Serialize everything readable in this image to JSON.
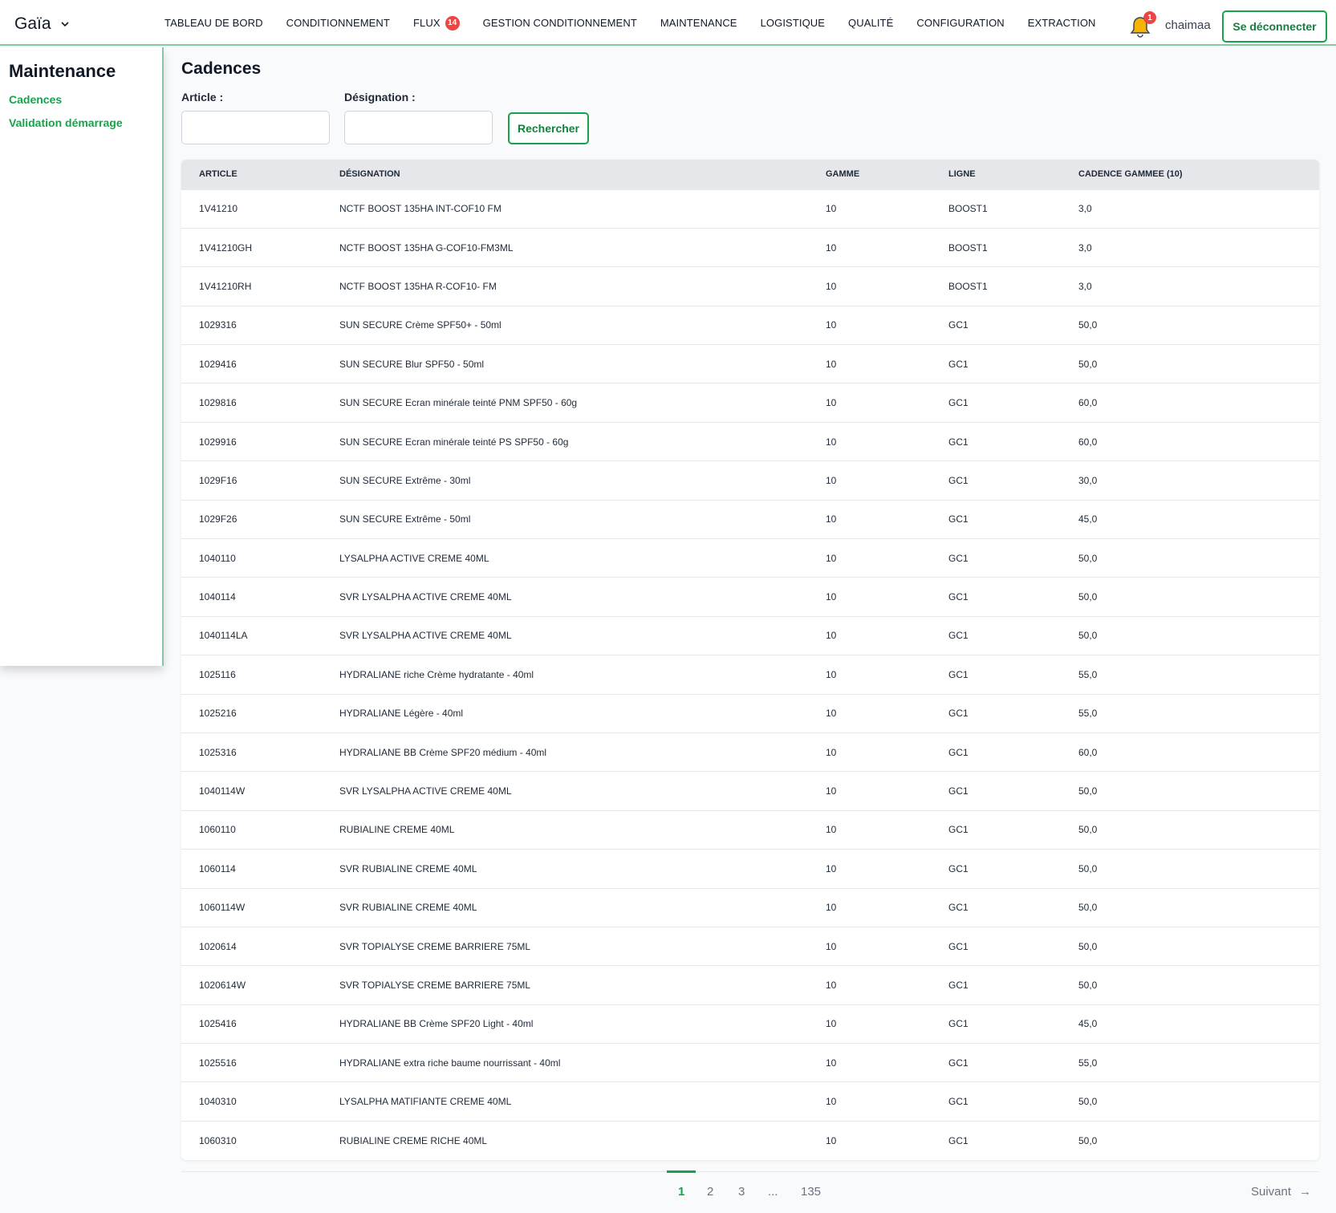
{
  "header": {
    "brand": "Gaïa",
    "nav": [
      {
        "label": "TABLEAU DE BORD"
      },
      {
        "label": "CONDITIONNEMENT"
      },
      {
        "label": "FLUX",
        "badge": "14"
      },
      {
        "label": "GESTION CONDITIONNEMENT"
      },
      {
        "label": "MAINTENANCE"
      },
      {
        "label": "LOGISTIQUE"
      },
      {
        "label": "QUALITÉ"
      },
      {
        "label": "CONFIGURATION"
      },
      {
        "label": "EXTRACTION"
      }
    ],
    "notification_count": "1",
    "username": "chaimaa",
    "logout_label": "Se déconnecter"
  },
  "sidebar": {
    "title": "Maintenance",
    "links": [
      {
        "label": "Cadences"
      },
      {
        "label": "Validation démarrage"
      }
    ]
  },
  "main": {
    "title": "Cadences",
    "filters": {
      "article_label": "Article :",
      "article_value": "",
      "designation_label": "Désignation :",
      "designation_value": "",
      "search_label": "Rechercher"
    },
    "table": {
      "columns": [
        "ARTICLE",
        "DÉSIGNATION",
        "GAMME",
        "LIGNE",
        "CADENCE GAMMEE (10)"
      ],
      "rows": [
        [
          "1V41210",
          "NCTF BOOST 135HA INT-COF10 FM",
          "10",
          "BOOST1",
          "3,0"
        ],
        [
          "1V41210GH",
          "NCTF BOOST 135HA G-COF10-FM3ML",
          "10",
          "BOOST1",
          "3,0"
        ],
        [
          "1V41210RH",
          "NCTF BOOST 135HA R-COF10- FM",
          "10",
          "BOOST1",
          "3,0"
        ],
        [
          "1029316",
          "SUN SECURE Crème SPF50+ - 50ml",
          "10",
          "GC1",
          "50,0"
        ],
        [
          "1029416",
          "SUN SECURE Blur SPF50 - 50ml",
          "10",
          "GC1",
          "50,0"
        ],
        [
          "1029816",
          "SUN SECURE Ecran minérale teinté PNM SPF50 - 60g",
          "10",
          "GC1",
          "60,0"
        ],
        [
          "1029916",
          "SUN SECURE Ecran minérale teinté PS SPF50 - 60g",
          "10",
          "GC1",
          "60,0"
        ],
        [
          "1029F16",
          "SUN SECURE Extrême - 30ml",
          "10",
          "GC1",
          "30,0"
        ],
        [
          "1029F26",
          "SUN SECURE Extrême - 50ml",
          "10",
          "GC1",
          "45,0"
        ],
        [
          "1040110",
          "LYSALPHA ACTIVE CREME 40ML",
          "10",
          "GC1",
          "50,0"
        ],
        [
          "1040114",
          "SVR LYSALPHA ACTIVE CREME 40ML",
          "10",
          "GC1",
          "50,0"
        ],
        [
          "1040114LA",
          "SVR LYSALPHA ACTIVE CREME 40ML",
          "10",
          "GC1",
          "50,0"
        ],
        [
          "1025116",
          "HYDRALIANE riche Crème hydratante - 40ml",
          "10",
          "GC1",
          "55,0"
        ],
        [
          "1025216",
          "HYDRALIANE Légère - 40ml",
          "10",
          "GC1",
          "55,0"
        ],
        [
          "1025316",
          "HYDRALIANE BB Crème SPF20 médium - 40ml",
          "10",
          "GC1",
          "60,0"
        ],
        [
          "1040114W",
          "SVR LYSALPHA ACTIVE CREME 40ML",
          "10",
          "GC1",
          "50,0"
        ],
        [
          "1060110",
          "RUBIALINE CREME 40ML",
          "10",
          "GC1",
          "50,0"
        ],
        [
          "1060114",
          "SVR RUBIALINE CREME 40ML",
          "10",
          "GC1",
          "50,0"
        ],
        [
          "1060114W",
          "SVR RUBIALINE CREME 40ML",
          "10",
          "GC1",
          "50,0"
        ],
        [
          "1020614",
          "SVR TOPIALYSE CREME BARRIERE 75ML",
          "10",
          "GC1",
          "50,0"
        ],
        [
          "1020614W",
          "SVR TOPIALYSE CREME BARRIERE 75ML",
          "10",
          "GC1",
          "50,0"
        ],
        [
          "1025416",
          "HYDRALIANE BB Crème SPF20 Light - 40ml",
          "10",
          "GC1",
          "45,0"
        ],
        [
          "1025516",
          "HYDRALIANE extra riche baume nourrissant - 40ml",
          "10",
          "GC1",
          "55,0"
        ],
        [
          "1040310",
          "LYSALPHA MATIFIANTE CREME 40ML",
          "10",
          "GC1",
          "50,0"
        ],
        [
          "1060310",
          "RUBIALINE CREME RICHE 40ML",
          "10",
          "GC1",
          "50,0"
        ]
      ]
    },
    "pagination": {
      "pages": [
        "1",
        "2",
        "3",
        "...",
        "135"
      ],
      "current": "1",
      "next_label": "Suivant",
      "next_arrow": "→"
    }
  },
  "colors": {
    "accent": "#16a34a",
    "badge": "#ef4444",
    "bell": "#f5b400"
  }
}
